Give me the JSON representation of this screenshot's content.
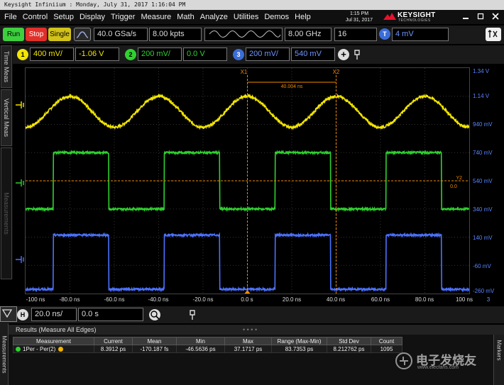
{
  "window": {
    "title": "Keysight Infiniium : Monday, July 31, 2017 1:16:04 PM",
    "time": "1:15 PM",
    "date": "Jul 31, 2017",
    "brand": "KEYSIGHT",
    "brand_sub": "TECHNOLOGIES"
  },
  "menu": [
    "File",
    "Control",
    "Setup",
    "Display",
    "Trigger",
    "Measure",
    "Math",
    "Analyze",
    "Utilities",
    "Demos",
    "Help"
  ],
  "toolbar": {
    "run": "Run",
    "stop": "Stop",
    "single": "Single",
    "sample_rate": "40.0 GSa/s",
    "memory_depth": "8.00 kpts",
    "bandwidth": "8.00 GHz",
    "averages": "16",
    "trigger_badge": "T",
    "trigger_level": "4 mV"
  },
  "channels": [
    {
      "num": "1",
      "scale": "400 mV/",
      "offset": "-1.06 V",
      "color": "#f3e600"
    },
    {
      "num": "2",
      "scale": "200 mV/",
      "offset": "0.0 V",
      "color": "#2fd12f"
    },
    {
      "num": "3",
      "scale": "200 mV/",
      "offset": "540 mV",
      "color": "#4b72ff"
    }
  ],
  "side_tabs": [
    "Time Meas",
    "Vertical Meas",
    "Measurements"
  ],
  "voltage_labels": [
    "1.34 V",
    "1.14 V",
    "940 mV",
    "740 mV",
    "540 mV",
    "340 mV",
    "140 mV",
    "-60 mV",
    "-260 mV"
  ],
  "time_labels": [
    "-100 ns",
    "-80.0 ns",
    "-60.0 ns",
    "-40.0 ns",
    "-20.0 ns",
    "0.0 s",
    "20.0 ns",
    "40.0 ns",
    "60.0 ns",
    "80.0 ns",
    "100 ns"
  ],
  "page_index": "3",
  "markers": {
    "x1_label": "X1",
    "x2_label": "X2",
    "x1_time_ns": 0,
    "x2_time_ns": 40,
    "delta": "40.004 ns",
    "y_label": "Y2",
    "y_value": "0.0"
  },
  "horizontal": {
    "badge": "H",
    "scale": "20.0 ns/",
    "position": "0.0 s"
  },
  "results": {
    "title": "Results   (Measure All Edges)",
    "left_tab": "Measurements",
    "right_tab": "Markers",
    "columns": [
      "Measurement",
      "Current",
      "Mean",
      "Min",
      "Max",
      "Range (Max-Min)",
      "Std Dev",
      "Count"
    ],
    "rows": [
      [
        "1Per - Per(2)",
        "8.3912 ps",
        "-170.187 fs",
        "-46.5636 ps",
        "37.1717 ps",
        "83.7353 ps",
        "8.212762 ps",
        "1095"
      ]
    ]
  },
  "watermark": {
    "text": "电子发烧友",
    "url": "www.elecfans.com"
  },
  "chart_data": {
    "type": "line",
    "x_range_ns": [
      -100,
      100
    ],
    "screen_range_mV": [
      -260,
      1340
    ],
    "grid": true,
    "series": [
      {
        "name": "1",
        "color": "#f3e600",
        "shape": "sine",
        "period_ns": 40,
        "high_mV": 1140,
        "low_mV": 920,
        "peak_at_ns": 0
      },
      {
        "name": "2",
        "color": "#2fd12f",
        "shape": "square",
        "period_ns": 50,
        "high_mV": 740,
        "low_mV": 340,
        "first_rise_ns": -87.5,
        "duty": 0.5
      },
      {
        "name": "3",
        "color": "#4b72ff",
        "shape": "square",
        "period_ns": 50,
        "high_mV": 155,
        "low_mV": -230,
        "first_rise_ns": -87.5,
        "duty": 0.5
      }
    ]
  }
}
